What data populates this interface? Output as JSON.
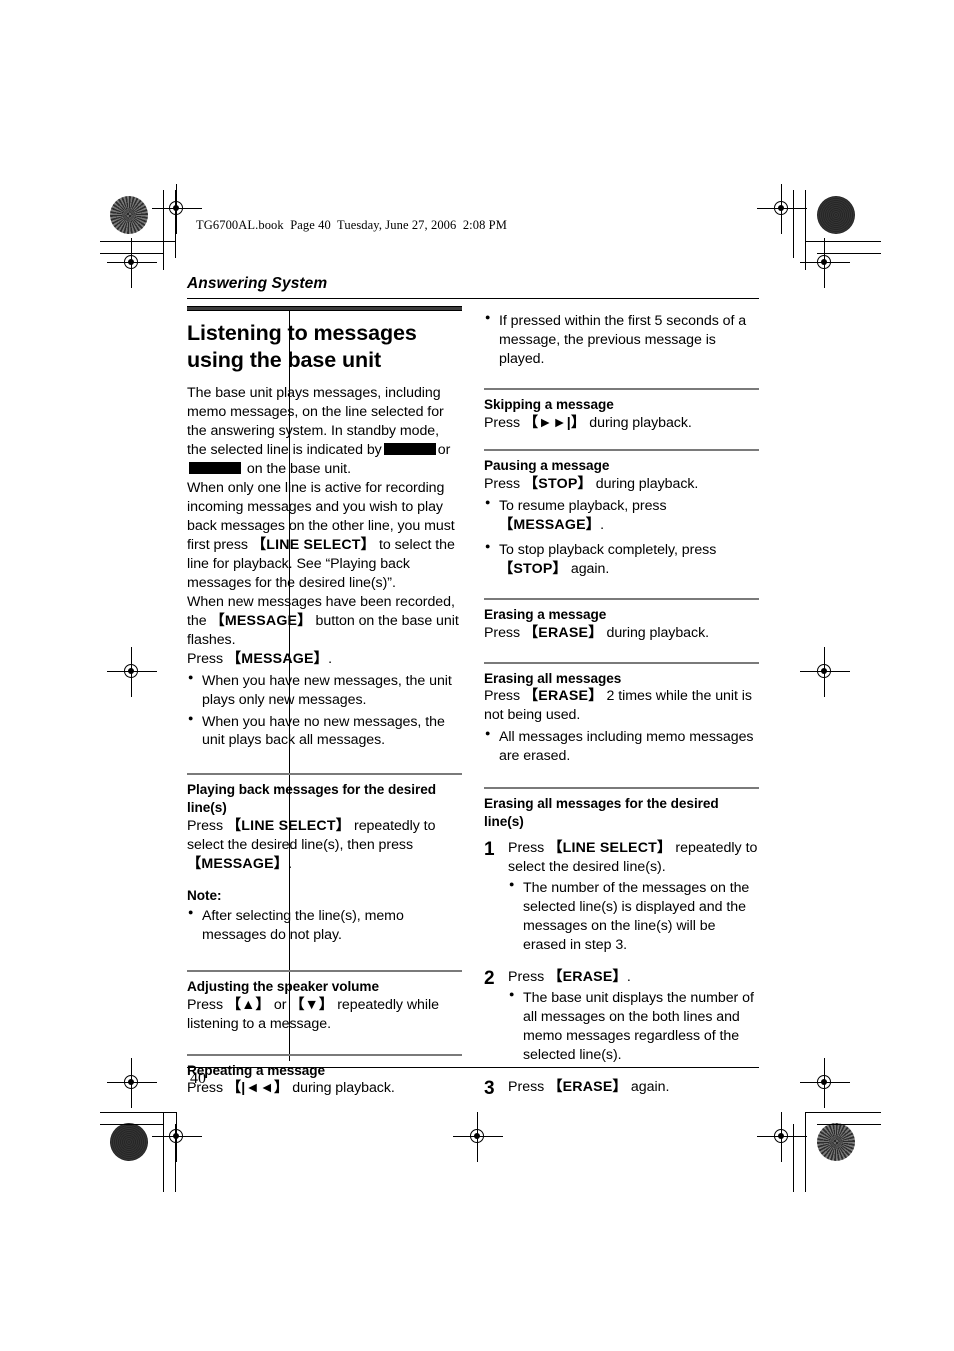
{
  "print_marks": {
    "file_bar": "TG6700AL.book  Page 40  Tuesday, June 27, 2006  2:08 PM"
  },
  "section": {
    "running_head": "Answering System",
    "page_number": "40"
  },
  "left_column": {
    "title": "Listening to messages using the base unit",
    "intro_1": "The base unit plays messages, including memo messages, on the line selected for the answering system. In standby mode, the selected line is indicated by",
    "intro_1_mid": "or",
    "intro_1_end": "on the base unit.",
    "intro_2_a": "When only one line is active for recording incoming messages and you wish to play back messages on the other line, you must first press",
    "intro_2_key": "【LINE SELECT】",
    "intro_2_b": "to select the line for playback. See “Playing back messages for the desired line(s)”.",
    "intro_3_a": "When new messages have been recorded, the",
    "intro_3_key": "【MESSAGE】",
    "intro_3_b": "button on the base unit flashes.",
    "intro_4_a": "Press",
    "intro_4_key": "【MESSAGE】",
    "intro_4_b": ".",
    "bullets": [
      "When you have new messages, the unit plays only new messages.",
      "When you have no new messages, the unit plays back all messages."
    ],
    "playback_section": {
      "heading": "Playing back messages for the desired line(s)",
      "body_a": "Press",
      "key_1": "【LINE SELECT】",
      "body_b": "repeatedly to select the desired line(s), then press",
      "key_2": "【MESSAGE】",
      "body_c": "."
    },
    "note_section": {
      "heading": "Note:",
      "bullets": [
        "After selecting the line(s), memo messages do not play."
      ]
    },
    "volume_section": {
      "heading": "Adjusting the speaker volume",
      "body_a": "Press",
      "key_up": "【▲】",
      "body_b": "or",
      "key_down": "【▼】",
      "body_c": "repeatedly while listening to a message."
    },
    "repeat_section": {
      "heading": "Repeating a message",
      "body_a": "Press",
      "key": "【|◄◄】",
      "body_b": "during playback."
    }
  },
  "right_column": {
    "top_bullets": [
      "If pressed within the first 5 seconds of a message, the previous message is played."
    ],
    "skipping_section": {
      "heading": "Skipping a message",
      "body_a": "Press",
      "key": "【►►|】",
      "body_b": "during playback."
    },
    "pausing_section": {
      "heading": "Pausing a message",
      "body_a": "Press",
      "key": "【STOP】",
      "body_b": "during playback.",
      "bullet_1_a": "To resume playback, press",
      "bullet_1_key": "【MESSAGE】",
      "bullet_1_b": ".",
      "bullet_2_a": "To stop playback completely, press",
      "bullet_2_key": "【STOP】",
      "bullet_2_b": "again."
    },
    "erasing_one_section": {
      "heading": "Erasing a message",
      "body_a": "Press",
      "key": "【ERASE】",
      "body_b": "during playback."
    },
    "erasing_all_section": {
      "heading": "Erasing all messages",
      "body_a": "Press",
      "key": "【ERASE】",
      "body_b": "2 times while the unit is not being used.",
      "bullets": [
        "All messages including memo messages are erased."
      ]
    },
    "erasing_line_section": {
      "heading": "Erasing all messages for the desired line(s)",
      "steps": [
        {
          "num": "1",
          "text_a": "Press",
          "key": "【LINE SELECT】",
          "text_b": "repeatedly to select the desired line(s).",
          "bullets": [
            "The number of the messages on the selected line(s) is displayed and the messages on the line(s) will be erased in step 3."
          ]
        },
        {
          "num": "2",
          "text_a": "Press",
          "key": "【ERASE】",
          "text_b": ".",
          "bullets": [
            "The base unit displays the number of all messages on the both lines and memo messages regardless of the selected line(s)."
          ]
        },
        {
          "num": "3",
          "text_a": "Press",
          "key": "【ERASE】",
          "text_b": "again.",
          "bullets": []
        }
      ]
    }
  }
}
